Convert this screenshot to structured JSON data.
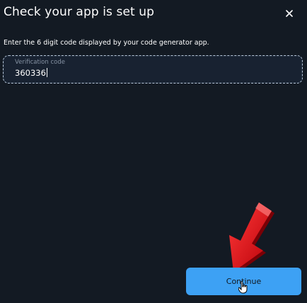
{
  "dialog": {
    "title": "Check your app is set up",
    "close_icon": "close-icon"
  },
  "instruction": "Enter the 6 digit code displayed by your code generator app.",
  "verification": {
    "label": "Verification code",
    "value": "360336"
  },
  "continue_label": "Continue",
  "colors": {
    "background": "#131a23",
    "accent": "#3da1f4",
    "field_border": "#b7c6d8",
    "arrow": "#e8121b"
  },
  "icons": {
    "arrow": "red-arrow-annotation",
    "cursor": "hand-pointer-icon"
  }
}
